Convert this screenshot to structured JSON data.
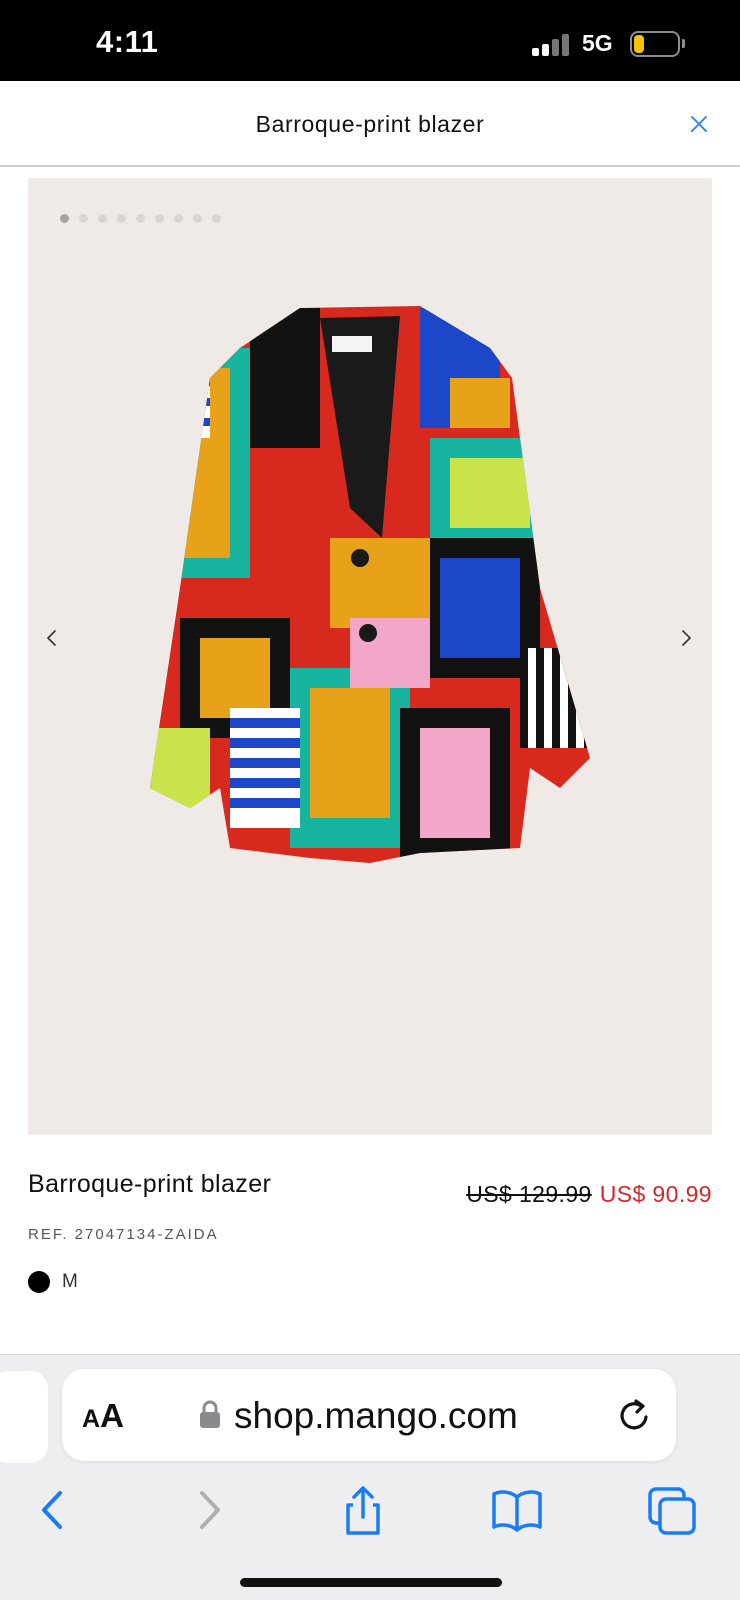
{
  "status_bar": {
    "time": "4:11",
    "network": "5G"
  },
  "header": {
    "title": "Barroque-print blazer"
  },
  "gallery": {
    "dot_count": 9,
    "active_index": 0
  },
  "product": {
    "name": "Barroque-print blazer",
    "price_old": "US$ 129.99",
    "price_new": "US$ 90.99",
    "ref": "REF. 27047134-ZAIDA",
    "size": "M",
    "color_swatch": "#000000"
  },
  "browser": {
    "aa_small": "A",
    "aa_large": "A",
    "url": "shop.mango.com"
  },
  "colors": {
    "accent_blue": "#1a7cf5",
    "sale_red": "#d0282a"
  }
}
